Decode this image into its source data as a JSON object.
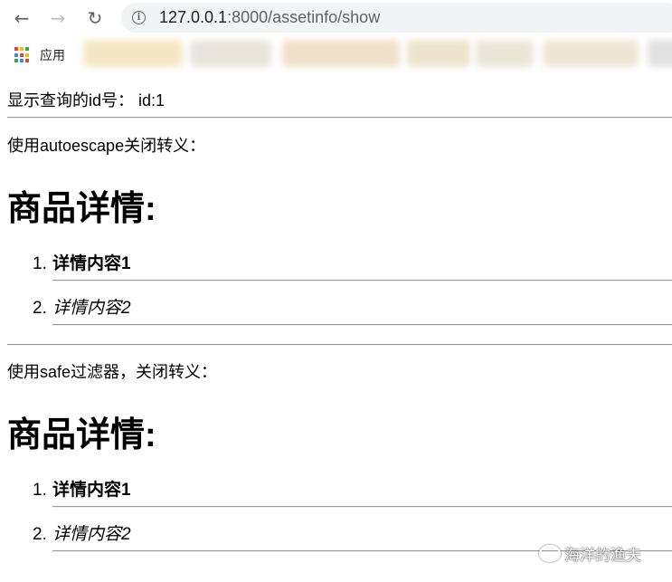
{
  "browser": {
    "url_host": "127.0.0.1",
    "url_rest": ":8000/assetinfo/show",
    "bookmarks_label": "应用"
  },
  "page": {
    "id_line": "显示查询的id号：  id:1",
    "autoescape_line": "使用autoescape关闭转义：",
    "section1": {
      "heading": "商品详情:",
      "items": [
        {
          "num": "1.",
          "text": "详情内容1"
        },
        {
          "num": "2.",
          "text": "详情内容2"
        }
      ]
    },
    "safe_line": "使用safe过滤器，关闭转义：",
    "section2": {
      "heading": "商品详情:",
      "items": [
        {
          "num": "1.",
          "text": "详情内容1"
        },
        {
          "num": "2.",
          "text": "详情内容2"
        }
      ]
    }
  },
  "watermark": {
    "text": "海洋的渔夫"
  },
  "colors": {
    "apps_icon": [
      "#ea4335",
      "#fbbc05",
      "#34a853",
      "#4285f4"
    ],
    "bookmark_blur": [
      "#f6d58c",
      "#d9d9d9",
      "#f3c96a",
      "#e6e6e6"
    ]
  }
}
